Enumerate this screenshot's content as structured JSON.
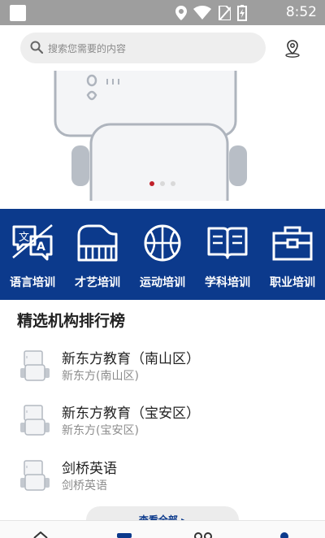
{
  "status_bar": {
    "time": "8:52",
    "icons": [
      "location-icon",
      "wifi-icon",
      "sim-icon",
      "battery-charging-icon"
    ]
  },
  "search": {
    "placeholder": "搜索您需要的内容",
    "icons": [
      "search-icon",
      "location-pin-icon"
    ]
  },
  "banner": {
    "page_count": 3,
    "active_page": 1
  },
  "categories": [
    {
      "label": "语言培训",
      "icon": "translate-icon"
    },
    {
      "label": "才艺培训",
      "icon": "piano-icon"
    },
    {
      "label": "运动培训",
      "icon": "basketball-icon"
    },
    {
      "label": "学科培训",
      "icon": "book-icon"
    },
    {
      "label": "职业培训",
      "icon": "toolbox-icon"
    }
  ],
  "ranking": {
    "title": "精选机构排行榜",
    "items": [
      {
        "name": "新东方教育（南山区）",
        "sub": "新东方(南山区)"
      },
      {
        "name": "新东方教育（宝安区）",
        "sub": "新东方(宝安区)"
      },
      {
        "name": "剑桥英语",
        "sub": "剑桥英语"
      }
    ],
    "view_all": "查看全部 ▸"
  },
  "colors": {
    "brand_blue": "#0c3a8c",
    "dot_active": "#c0202a",
    "status_bar": "#9e9e9e"
  }
}
